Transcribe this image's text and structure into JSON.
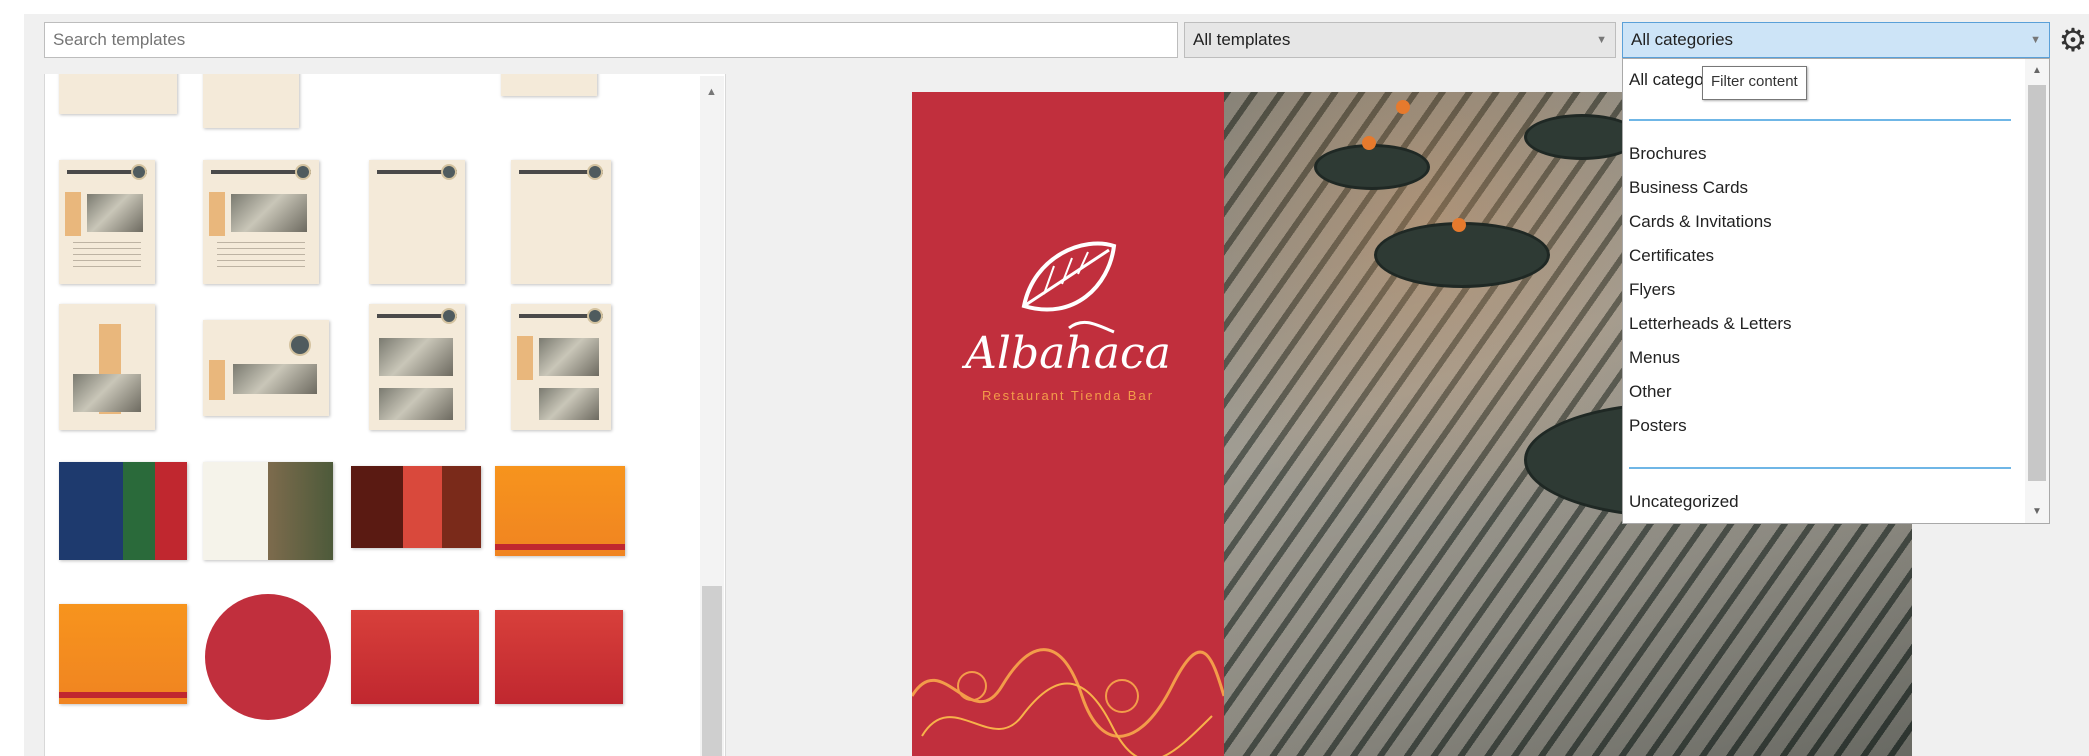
{
  "toolbar": {
    "search_placeholder": "Search templates",
    "template_filter": "All templates",
    "category_filter": "All categories",
    "settings_icon": "gear-icon"
  },
  "dropdown": {
    "items": [
      "All categories",
      "Brochures",
      "Business Cards",
      "Cards & Invitations",
      "Certificates",
      "Flyers",
      "Letterheads & Letters",
      "Menus",
      "Other",
      "Posters",
      "Uncategorized"
    ],
    "tooltip": "Filter content",
    "accent": "#6fb6e6"
  },
  "preview": {
    "brand_name": "Albahaca",
    "tagline": "Restaurant Tienda Bar",
    "cover_color": "#c12f3d"
  }
}
